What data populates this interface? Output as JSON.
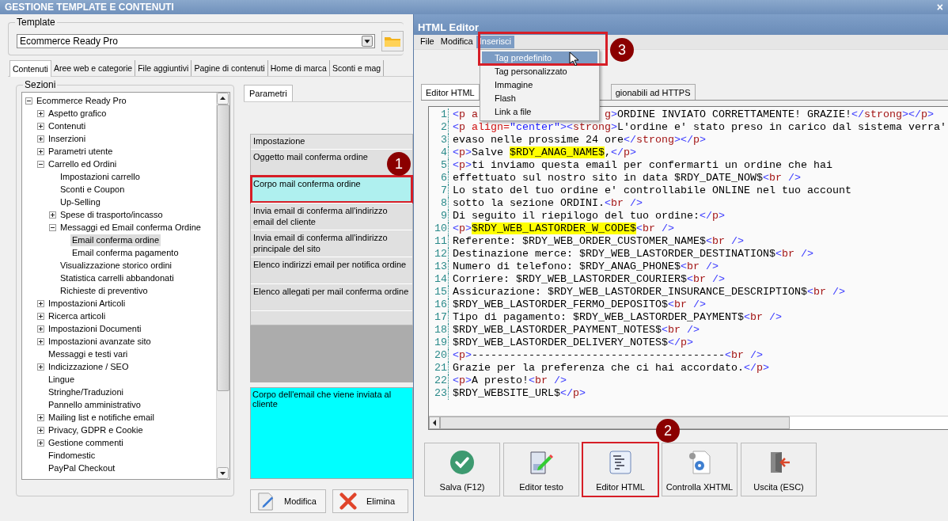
{
  "window": {
    "title": "GESTIONE TEMPLATE E CONTENUTI",
    "close": "×"
  },
  "template": {
    "label": "Template",
    "value": "Ecommerce Ready Pro"
  },
  "tabs": [
    {
      "label": "Contenuti",
      "selected": true
    },
    {
      "label": "Aree web e categorie",
      "selected": false
    },
    {
      "label": "File aggiuntivi",
      "selected": false
    },
    {
      "label": "Pagine di contenuti",
      "selected": false
    },
    {
      "label": "Home di marca",
      "selected": false
    },
    {
      "label": "Sconti e mag",
      "selected": false
    }
  ],
  "sections": {
    "label": "Sezioni",
    "tree": [
      {
        "label": "Ecommerce Ready Pro",
        "expanded": true,
        "selected": false,
        "children": [
          {
            "label": "Aspetto grafico",
            "expanded": false,
            "selected": false
          },
          {
            "label": "Contenuti",
            "expanded": false,
            "selected": false
          },
          {
            "label": "Inserzioni",
            "expanded": false,
            "selected": false
          },
          {
            "label": "Parametri utente",
            "expanded": false,
            "selected": false
          },
          {
            "label": "Carrello ed Ordini",
            "expanded": true,
            "selected": false,
            "children": [
              {
                "label": "Impostazioni carrello",
                "selected": false
              },
              {
                "label": "Sconti e Coupon",
                "selected": false
              },
              {
                "label": "Up-Selling",
                "selected": false
              },
              {
                "label": "Spese di trasporto/incasso",
                "expanded": false,
                "selected": false
              },
              {
                "label": "Messaggi ed Email conferma Ordine",
                "expanded": true,
                "selected": false,
                "children": [
                  {
                    "label": "Email conferma ordine",
                    "selected": true
                  },
                  {
                    "label": "Email conferma pagamento",
                    "selected": false
                  }
                ]
              },
              {
                "label": "Visualizzazione storico ordini",
                "selected": false
              },
              {
                "label": "Statistica carrelli abbandonati",
                "selected": false
              },
              {
                "label": "Richieste di preventivo",
                "selected": false
              }
            ]
          },
          {
            "label": "Impostazioni Articoli",
            "expanded": false,
            "selected": false
          },
          {
            "label": "Ricerca articoli",
            "expanded": false,
            "selected": false
          },
          {
            "label": "Impostazioni Documenti",
            "expanded": false,
            "selected": false
          },
          {
            "label": "Impostazioni avanzate sito",
            "expanded": false,
            "selected": false
          },
          {
            "label": "Messaggi e testi vari",
            "selected": false
          },
          {
            "label": "Indicizzazione / SEO",
            "expanded": false,
            "selected": false
          },
          {
            "label": "Lingue",
            "selected": false
          },
          {
            "label": "Stringhe/Traduzioni",
            "selected": false
          },
          {
            "label": "Pannello amministrativo",
            "selected": false
          },
          {
            "label": "Mailing list e notifiche email",
            "expanded": false,
            "selected": false
          },
          {
            "label": "Privacy, GDPR e Cookie",
            "expanded": false,
            "selected": false
          },
          {
            "label": "Gestione commenti",
            "expanded": false,
            "selected": false
          },
          {
            "label": "Findomestic",
            "selected": false
          },
          {
            "label": "PayPal Checkout",
            "selected": false
          }
        ]
      }
    ]
  },
  "parameters": {
    "tab": "Parametri",
    "header": "Impostazione",
    "rows": [
      {
        "label": "Oggetto mail conferma ordine",
        "selected": false
      },
      {
        "label": "Corpo mail conferma ordine",
        "selected": true,
        "callout": "1"
      },
      {
        "label": "Invia email di conferma all'indirizzo email del cliente",
        "selected": false
      },
      {
        "label": "Invia email di conferma all'indirizzo principale del sito",
        "selected": false
      },
      {
        "label": "Elenco indirizzi email per notifica ordine",
        "selected": false
      },
      {
        "label": "Elenco allegati per mail conferma ordine",
        "selected": false
      }
    ],
    "description": "Corpo dell'email che viene inviata al cliente",
    "buttons": [
      {
        "label": "Modifica",
        "kind": "edit"
      },
      {
        "label": "Elimina",
        "kind": "delete"
      }
    ]
  },
  "editor": {
    "title": "HTML Editor",
    "menu": [
      {
        "label": "File",
        "selected": false
      },
      {
        "label": "Modifica",
        "selected": false
      },
      {
        "label": "Inserisci",
        "selected": true,
        "callout": "3"
      }
    ],
    "dropdown": [
      {
        "label": "Tag predefinito",
        "selected": true
      },
      {
        "label": "Tag personalizzato",
        "selected": false
      },
      {
        "label": "Immagine",
        "selected": false
      },
      {
        "label": "Flash",
        "selected": false
      },
      {
        "label": "Link a file",
        "selected": false
      }
    ],
    "tabs": [
      {
        "label": "Editor HTML",
        "selected": true
      },
      {
        "label": "gionabili ad HTTPS",
        "selected": false
      }
    ],
    "lines": [
      {
        "number": "1",
        "tokens": [
          {
            "kind": "tag",
            "text": "<p a"
          }
        ],
        "tokens_after_menu": [
          {
            "kind": "tag",
            "text": "g>"
          },
          {
            "kind": "text",
            "text": "ORDINE INVIATO CORRETTAMENTE! GRAZIE!"
          },
          {
            "kind": "tag",
            "text": "</strong></p>"
          }
        ]
      },
      {
        "number": "2",
        "tokens": [
          {
            "kind": "tag",
            "text": "<p "
          },
          {
            "kind": "attr",
            "text": "align="
          },
          {
            "kind": "value",
            "text": "\"center\""
          },
          {
            "kind": "tag",
            "text": "><strong>"
          },
          {
            "kind": "text",
            "text": "L'ordine e' stato preso in carico dal sistema verra'"
          }
        ]
      },
      {
        "number": "3",
        "tokens": [
          {
            "kind": "text",
            "text": "evaso nelle prossime 24 ore"
          },
          {
            "kind": "tag",
            "text": "</strong></p>"
          }
        ]
      },
      {
        "number": "4",
        "tokens": [
          {
            "kind": "tag",
            "text": "<p>"
          },
          {
            "kind": "text",
            "text": "Salve "
          },
          {
            "kind": "highlight",
            "text": "$RDY_ANAG_NAME$"
          },
          {
            "kind": "text",
            "text": ","
          },
          {
            "kind": "tag",
            "text": "</p>"
          }
        ]
      },
      {
        "number": "5",
        "tokens": [
          {
            "kind": "tag",
            "text": "<p>"
          },
          {
            "kind": "text",
            "text": "ti inviamo questa email per confermarti un ordine che hai"
          }
        ]
      },
      {
        "number": "6",
        "tokens": [
          {
            "kind": "text",
            "text": "effettuato sul nostro sito in data $RDY_DATE_NOW$"
          },
          {
            "kind": "tag",
            "text": "<br />"
          }
        ]
      },
      {
        "number": "7",
        "tokens": [
          {
            "kind": "text",
            "text": "Lo stato del tuo ordine e' controllabile ONLINE nel tuo account"
          }
        ]
      },
      {
        "number": "8",
        "tokens": [
          {
            "kind": "text",
            "text": "sotto la sezione ORDINI."
          },
          {
            "kind": "tag",
            "text": "<br />"
          }
        ]
      },
      {
        "number": "9",
        "tokens": [
          {
            "kind": "text",
            "text": "Di seguito il riepilogo del tuo ordine:"
          },
          {
            "kind": "tag",
            "text": "</p>"
          }
        ]
      },
      {
        "number": "10",
        "tokens": [
          {
            "kind": "tag",
            "text": "<p>"
          },
          {
            "kind": "highlight",
            "text": "$RDY_WEB_LASTORDER_W_CODE$"
          },
          {
            "kind": "tag",
            "text": "<br />"
          }
        ]
      },
      {
        "number": "11",
        "tokens": [
          {
            "kind": "text",
            "text": "Referente: $RDY_WEB_ORDER_CUSTOMER_NAME$"
          },
          {
            "kind": "tag",
            "text": "<br />"
          }
        ]
      },
      {
        "number": "12",
        "tokens": [
          {
            "kind": "text",
            "text": "Destinazione merce: $RDY_WEB_LASTORDER_DESTINATION$"
          },
          {
            "kind": "tag",
            "text": "<br />"
          }
        ]
      },
      {
        "number": "13",
        "tokens": [
          {
            "kind": "text",
            "text": "Numero di telefono: $RDY_ANAG_PHONE$"
          },
          {
            "kind": "tag",
            "text": "<br />"
          }
        ]
      },
      {
        "number": "14",
        "tokens": [
          {
            "kind": "text",
            "text": "Corriere: $RDY_WEB_LASTORDER_COURIER$"
          },
          {
            "kind": "tag",
            "text": "<br />"
          }
        ]
      },
      {
        "number": "15",
        "tokens": [
          {
            "kind": "text",
            "text": "Assicurazione: $RDY_WEB_LASTORDER_INSURANCE_DESCRIPTION$"
          },
          {
            "kind": "tag",
            "text": "<br />"
          }
        ]
      },
      {
        "number": "16",
        "tokens": [
          {
            "kind": "text",
            "text": "$RDY_WEB_LASTORDER_FERMO_DEPOSITO$"
          },
          {
            "kind": "tag",
            "text": "<br />"
          }
        ]
      },
      {
        "number": "17",
        "tokens": [
          {
            "kind": "text",
            "text": "Tipo di pagamento: $RDY_WEB_LASTORDER_PAYMENT$"
          },
          {
            "kind": "tag",
            "text": "<br />"
          }
        ]
      },
      {
        "number": "18",
        "tokens": [
          {
            "kind": "text",
            "text": "$RDY_WEB_LASTORDER_PAYMENT_NOTES$"
          },
          {
            "kind": "tag",
            "text": "<br />"
          }
        ]
      },
      {
        "number": "19",
        "tokens": [
          {
            "kind": "text",
            "text": "$RDY_WEB_LASTORDER_DELIVERY_NOTES$"
          },
          {
            "kind": "tag",
            "text": "</p>"
          }
        ]
      },
      {
        "number": "20",
        "tokens": [
          {
            "kind": "tag",
            "text": "<p>"
          },
          {
            "kind": "text",
            "text": "----------------------------------------"
          },
          {
            "kind": "tag",
            "text": "<br />"
          }
        ]
      },
      {
        "number": "21",
        "tokens": [
          {
            "kind": "text",
            "text": "Grazie per la preferenza che ci hai accordato."
          },
          {
            "kind": "tag",
            "text": "</p>"
          }
        ]
      },
      {
        "number": "22",
        "tokens": [
          {
            "kind": "tag",
            "text": "<p>"
          },
          {
            "kind": "text",
            "text": "A presto!"
          },
          {
            "kind": "tag",
            "text": "<br />"
          }
        ]
      },
      {
        "number": "23",
        "tokens": [
          {
            "kind": "text",
            "text": "$RDY_WEBSITE_URL$"
          },
          {
            "kind": "tag",
            "text": "</p>"
          }
        ]
      }
    ],
    "buttons": [
      {
        "label": "Salva (F12)",
        "kind": "save"
      },
      {
        "label": "Editor testo",
        "kind": "text"
      },
      {
        "label": "Editor HTML",
        "kind": "html",
        "callout": "2"
      },
      {
        "label": "Controlla XHTML",
        "kind": "check"
      },
      {
        "label": "Uscita (ESC)",
        "kind": "exit"
      }
    ]
  }
}
